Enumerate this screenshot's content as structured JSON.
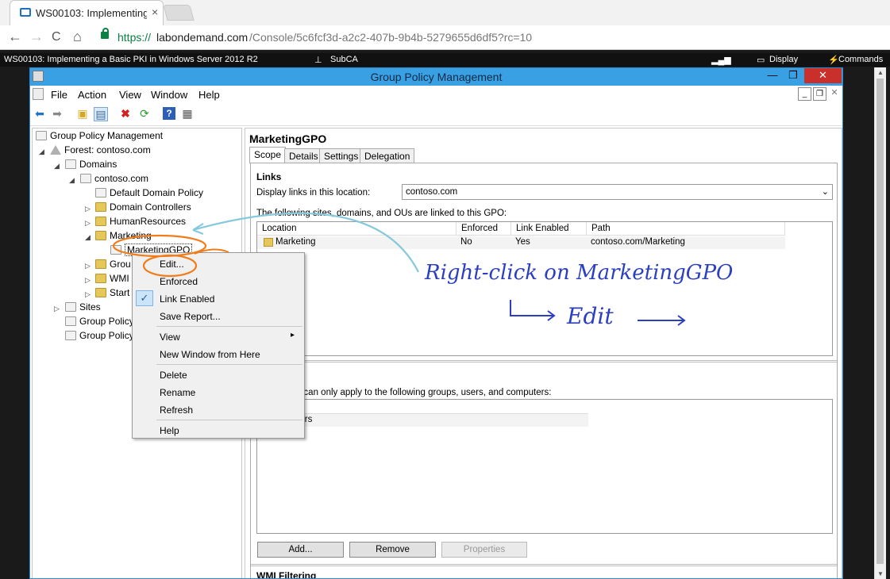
{
  "browser": {
    "tab_title": "WS00103: Implementing",
    "tab_close": "×",
    "url_scheme": "https://",
    "url_host": "labondemand.com",
    "url_path": "/Console/5c6fcf3d-a2c2-407b-9b4b-5279655d6df5?rc=10",
    "nav": {
      "back": "←",
      "forward": "→",
      "reload": "C",
      "home": "⌂"
    }
  },
  "labbar": {
    "title": "WS00103: Implementing a Basic PKI in Windows Server 2012 R2",
    "machine": "SubCA",
    "display": "Display",
    "commands": "Commands"
  },
  "window": {
    "title": "Group Policy Management",
    "menu": [
      "File",
      "Action",
      "View",
      "Window",
      "Help"
    ]
  },
  "tree": {
    "root": "Group Policy Management",
    "forest": "Forest: contoso.com",
    "domains": "Domains",
    "domain": "contoso.com",
    "default_policy": "Default Domain Policy",
    "domain_controllers": "Domain Controllers",
    "human_resources": "HumanResources",
    "marketing": "Marketing",
    "marketing_gpo": "MarketingGPO",
    "group_policy_objects": "Grou",
    "wmi_filters": "WMI",
    "starter_gpos": "Start",
    "sites": "Sites",
    "gp_modeling": "Group Policy",
    "gp_results": "Group Policy"
  },
  "details": {
    "gpo_name": "MarketingGPO",
    "tabs": [
      "Scope",
      "Details",
      "Settings",
      "Delegation"
    ],
    "links_heading": "Links",
    "display_links_label": "Display links in this location:",
    "display_links_value": "contoso.com",
    "linked_desc": "The following sites, domains, and OUs are linked to this GPO:",
    "links_columns": [
      "Location",
      "Enforced",
      "Link Enabled",
      "Path"
    ],
    "links_rows": [
      {
        "location": "Marketing",
        "enforced": "No",
        "link_enabled": "Yes",
        "path": "contoso.com/Marketing"
      }
    ],
    "security_heading": "tering",
    "security_desc": "n this GPO can only apply to the following groups, users, and computers:",
    "security_row": "cated Users",
    "buttons": {
      "add": "Add...",
      "remove": "Remove",
      "properties": "Properties"
    },
    "wmi_heading": "WMI Filtering"
  },
  "context_menu": {
    "items": [
      "Edit...",
      "Enforced",
      "Link Enabled",
      "Save Report...",
      "View",
      "New Window from Here",
      "Delete",
      "Rename",
      "Refresh",
      "Help"
    ],
    "checkmark": "✓",
    "submenu_arrow": "▸"
  },
  "annotation": {
    "line1": "Right-click on MarketingGPO",
    "line2": "Edit"
  },
  "colors": {
    "titlebar": "#3aa0e4",
    "accent_orange": "#f07d1a",
    "annotation_blue": "#2b3fc0",
    "arrow_cyan": "#86c9dd"
  }
}
